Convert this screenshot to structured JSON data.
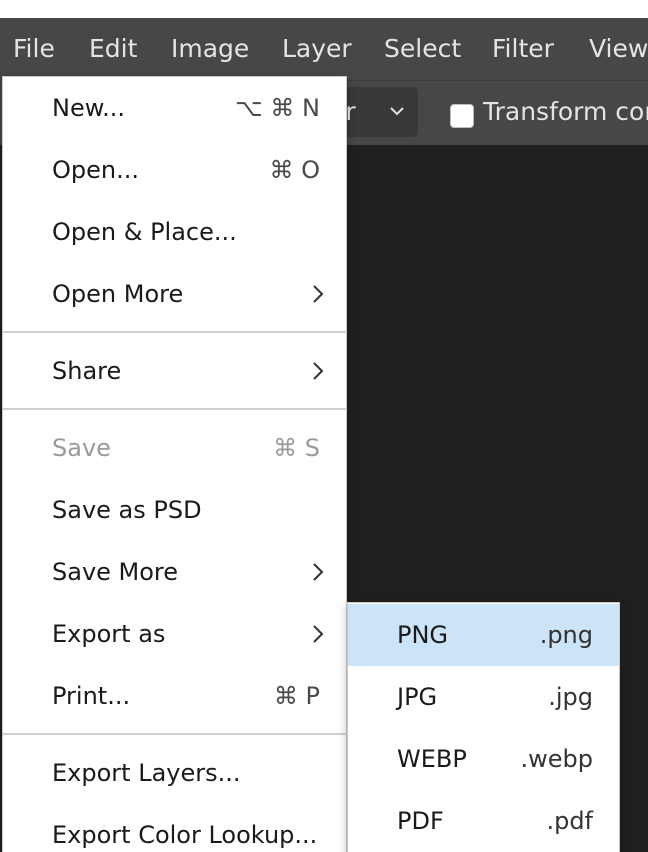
{
  "menubar": {
    "items": [
      "File",
      "Edit",
      "Image",
      "Layer",
      "Select",
      "Filter",
      "View"
    ]
  },
  "toolbar": {
    "select_value": "er",
    "transform_label": "Transform cor"
  },
  "file_menu": {
    "items": [
      {
        "label": "New...",
        "shortcut": "⌥ ⌘ N"
      },
      {
        "label": "Open...",
        "shortcut": "⌘ O"
      },
      {
        "label": "Open & Place..."
      },
      {
        "label": "Open More",
        "submenu": true
      },
      {
        "label": "Share",
        "submenu": true
      },
      {
        "label": "Save",
        "shortcut": "⌘ S",
        "disabled": true
      },
      {
        "label": "Save as PSD"
      },
      {
        "label": "Save More",
        "submenu": true
      },
      {
        "label": "Export as",
        "submenu": true
      },
      {
        "label": "Print...",
        "shortcut": "⌘ P"
      },
      {
        "label": "Export Layers..."
      },
      {
        "label": "Export Color Lookup..."
      }
    ]
  },
  "export_submenu": {
    "items": [
      {
        "name": "PNG",
        "ext": ".png",
        "highlighted": true
      },
      {
        "name": "JPG",
        "ext": ".jpg"
      },
      {
        "name": "WEBP",
        "ext": ".webp"
      },
      {
        "name": "PDF",
        "ext": ".pdf"
      }
    ]
  },
  "colors": {
    "menubar_bg": "#474747",
    "canvas_bg": "#202020",
    "highlight": "#cbe4f8"
  }
}
